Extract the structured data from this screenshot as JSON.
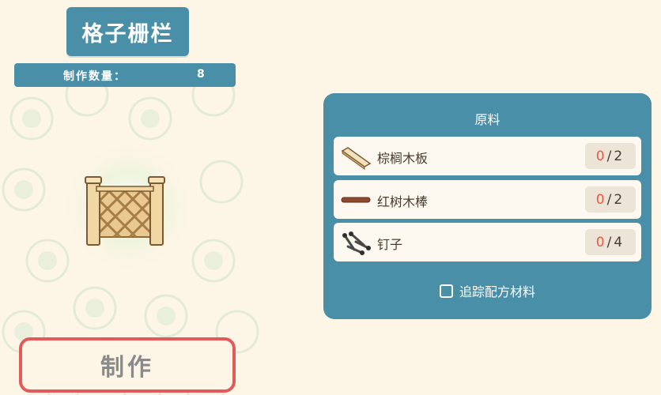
{
  "item": {
    "title": "格子栅栏",
    "quantity_label": "制作数量：",
    "quantity_value": "8",
    "image": "lattice-fence"
  },
  "craft_button": {
    "label": "制作"
  },
  "materials": {
    "title": "原料",
    "items": [
      {
        "name": "棕榈木板",
        "icon": "palm-plank-icon",
        "have": "0",
        "sep": "/",
        "need": "2"
      },
      {
        "name": "红树木棒",
        "icon": "mangrove-stick-icon",
        "have": "0",
        "sep": "/",
        "need": "2"
      },
      {
        "name": "钉子",
        "icon": "nails-icon",
        "have": "0",
        "sep": "/",
        "need": "4"
      }
    ],
    "track_label": "追踪配方材料"
  },
  "colors": {
    "background": "#fdf5e6",
    "panel": "#4a8fa8",
    "craft_border": "#e25b5b",
    "count_have": "#ea5a46"
  }
}
